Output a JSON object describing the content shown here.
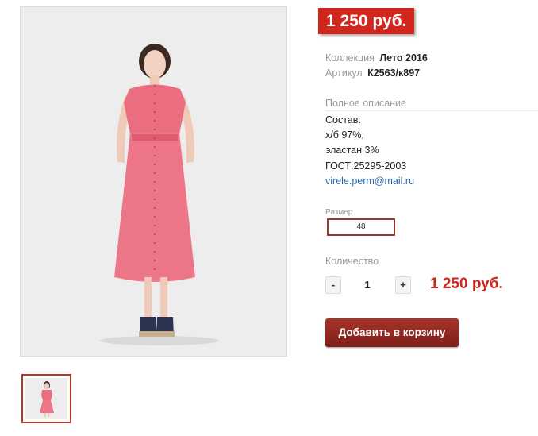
{
  "price_badge": "1 250 руб.",
  "collection": {
    "label": "Коллекция",
    "value": "Лето 2016"
  },
  "article": {
    "label": "Артикул",
    "value": "К2563/к897"
  },
  "description": {
    "title": "Полное описание",
    "lines": [
      "Состав:",
      "х/б 97%,",
      "эластан 3%",
      "ГОСТ:25295-2003"
    ],
    "email": "virele.perm@mail.ru"
  },
  "size": {
    "label": "Размер",
    "selected": "48"
  },
  "quantity": {
    "label": "Количество",
    "minus": "-",
    "value": "1",
    "plus": "+"
  },
  "total_price": "1 250 руб.",
  "cart_button": "Добавить в корзину",
  "colors": {
    "accent": "#d0261e",
    "button": "#8f2a20",
    "dress": "#ea6e80"
  }
}
